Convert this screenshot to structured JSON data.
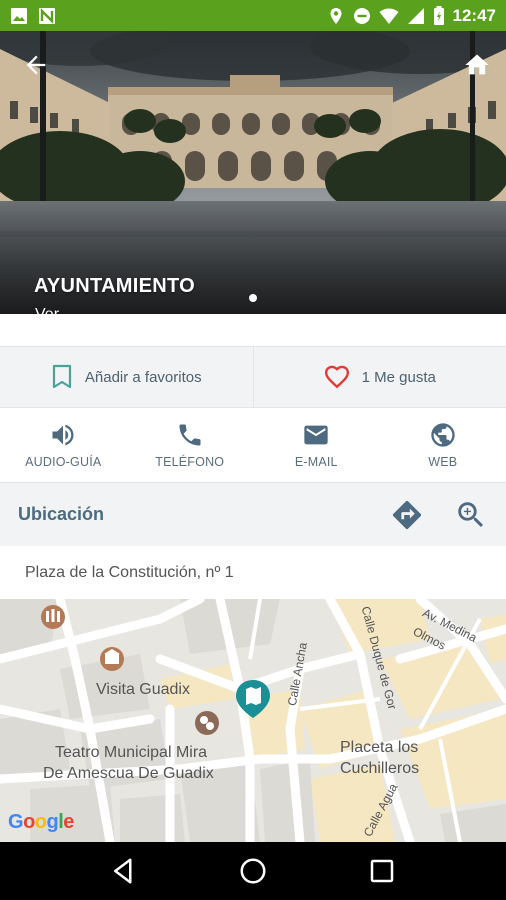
{
  "status_bar": {
    "time": "12:47",
    "icons": [
      "image-icon",
      "n-app-icon",
      "location-icon",
      "do-not-disturb-icon",
      "wifi-icon",
      "signal-icon",
      "battery-icon"
    ],
    "color": "#5aa11e"
  },
  "hero": {
    "title": "AYUNTAMIENTO",
    "subtitle": "Ver",
    "dots": 1
  },
  "favbar": {
    "favorite_label": "Añadir a favoritos",
    "like_label": "1 Me gusta",
    "favorite_color": "#4aa39a",
    "like_color": "#e53935"
  },
  "actions": [
    {
      "label": "AUDIO-GUÍA",
      "icon": "speaker-icon"
    },
    {
      "label": "TELÉFONO",
      "icon": "phone-icon"
    },
    {
      "label": "E-MAIL",
      "icon": "mail-icon"
    },
    {
      "label": "WEB",
      "icon": "globe-icon"
    }
  ],
  "location": {
    "title": "Ubicación",
    "address": "Plaza de la Constitución, nº 1",
    "icons": [
      "directions-icon",
      "zoom-in-icon"
    ]
  },
  "map": {
    "labels": {
      "visita": "Visita Guadix",
      "teatro_line1": "Teatro Municipal Mira",
      "teatro_line2": "De Amescua De Guadix",
      "placeta_line1": "Placeta los",
      "placeta_line2": "Cuchilleros",
      "calle_ancha": "Calle Ancha",
      "calle_duque": "Calle Duque de Gor",
      "av_medina": "Av. Medina Olmos",
      "calle_agua": "Calle Agua"
    },
    "attribution": "Google"
  },
  "nav_bar": [
    "back-nav-icon",
    "home-nav-icon",
    "recents-nav-icon"
  ]
}
